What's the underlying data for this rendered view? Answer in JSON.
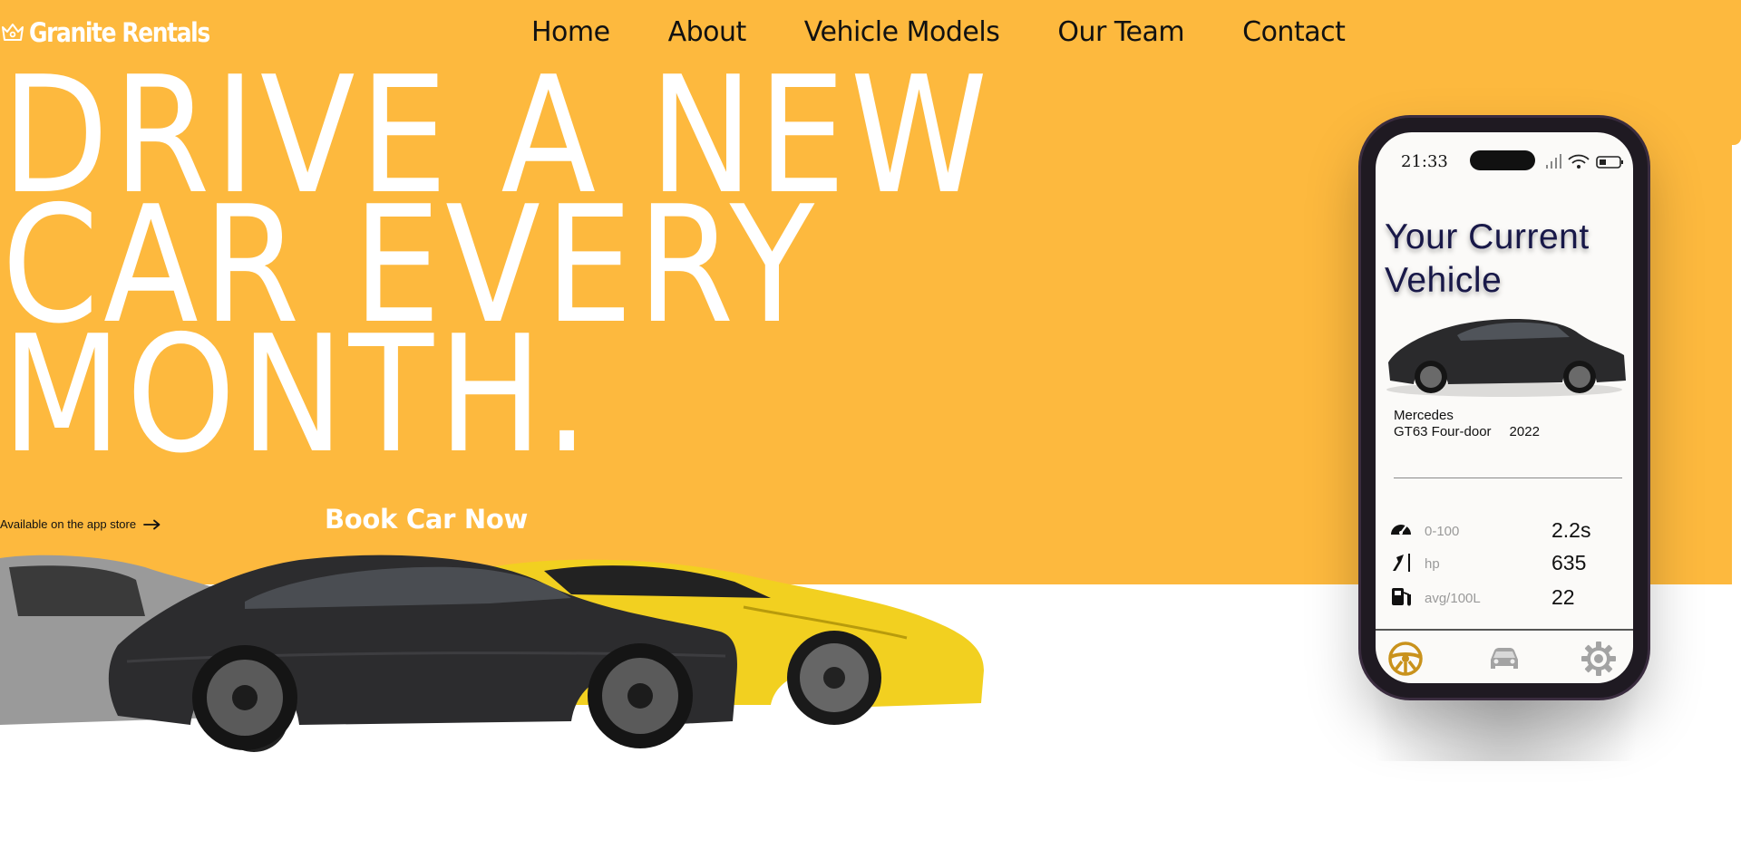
{
  "brand": {
    "name": "Granite Rentals",
    "logo_icon": "crown-icon",
    "accent_color": "#fdb93e"
  },
  "nav": {
    "items": [
      {
        "label": "Home"
      },
      {
        "label": "About"
      },
      {
        "label": "Vehicle Models"
      },
      {
        "label": "Our Team"
      },
      {
        "label": "Contact"
      }
    ]
  },
  "hero": {
    "headline_lines": [
      "DRIVE A NEW",
      "CAR EVERY",
      "MONTH."
    ],
    "app_store_text": "Available on the app store",
    "app_store_icon": "arrow-right-icon",
    "cta_label": "Book Car Now"
  },
  "phone": {
    "status_time": "21:33",
    "title_lines": [
      "Your Current",
      "Vehicle"
    ],
    "car": {
      "make": "Mercedes",
      "model": "GT63 Four-door",
      "year": "2022"
    },
    "stats": [
      {
        "icon": "speedometer-icon",
        "label": "0-100",
        "value": "2.2s"
      },
      {
        "icon": "horsepower-arrow-icon",
        "label": "hp",
        "value": "635"
      },
      {
        "icon": "fuel-pump-icon",
        "label": "avg/100L",
        "value": "22"
      }
    ],
    "tabs": [
      {
        "icon": "steering-wheel-icon",
        "active": true
      },
      {
        "icon": "car-icon",
        "active": false
      },
      {
        "icon": "settings-gear-icon",
        "active": false
      }
    ]
  }
}
